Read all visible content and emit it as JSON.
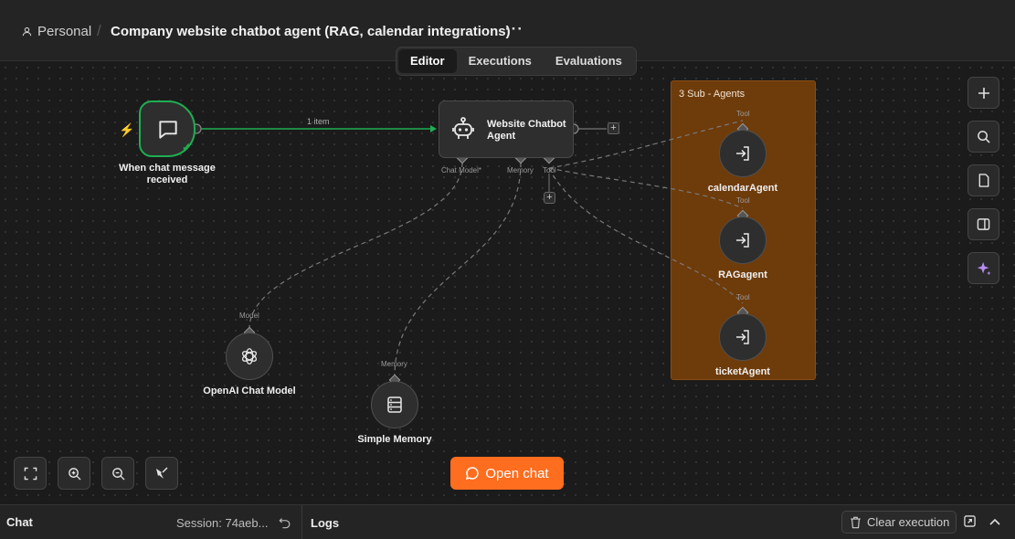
{
  "header": {
    "workspace": "Personal",
    "title": "Company website chatbot agent (RAG, calendar integrations)",
    "more": "···"
  },
  "tabs": [
    {
      "label": "Editor",
      "active": true
    },
    {
      "label": "Executions",
      "active": false
    },
    {
      "label": "Evaluations",
      "active": false
    }
  ],
  "nodes": {
    "trigger": {
      "label_line1": "When chat message",
      "label_line2": "received"
    },
    "agent": {
      "title_line1": "Website Chatbot",
      "title_line2": "Agent"
    },
    "connection_label": "1 item",
    "ports": {
      "chat_model": "Chat Model*",
      "memory": "Memory",
      "tool": "Tool"
    },
    "openai": {
      "label": "OpenAI Chat Model",
      "port": "Model"
    },
    "memory": {
      "label": "Simple Memory",
      "port": "Memory"
    },
    "sticky": {
      "text": "3 Sub - Agents"
    },
    "sub_agents": [
      {
        "label": "calendarAgent",
        "port": "Tool"
      },
      {
        "label": "RAGagent",
        "port": "Tool"
      },
      {
        "label": "ticketAgent",
        "port": "Tool"
      }
    ]
  },
  "controls": {
    "open_chat": "Open chat"
  },
  "bottom": {
    "chat_title": "Chat",
    "session": "Session: 74aeb...",
    "logs_title": "Logs",
    "clear_execution": "Clear execution"
  },
  "colors": {
    "accent": "#ff6d1f",
    "success": "#1fae52",
    "sticky": "#6e3b0b"
  }
}
